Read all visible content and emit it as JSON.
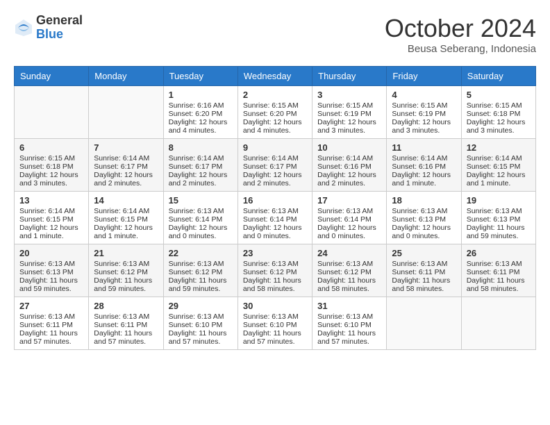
{
  "header": {
    "logo_general": "General",
    "logo_blue": "Blue",
    "month": "October 2024",
    "location": "Beusa Seberang, Indonesia"
  },
  "days_of_week": [
    "Sunday",
    "Monday",
    "Tuesday",
    "Wednesday",
    "Thursday",
    "Friday",
    "Saturday"
  ],
  "weeks": [
    [
      {
        "day": "",
        "sunrise": "",
        "sunset": "",
        "daylight": ""
      },
      {
        "day": "",
        "sunrise": "",
        "sunset": "",
        "daylight": ""
      },
      {
        "day": "1",
        "sunrise": "Sunrise: 6:16 AM",
        "sunset": "Sunset: 6:20 PM",
        "daylight": "Daylight: 12 hours and 4 minutes."
      },
      {
        "day": "2",
        "sunrise": "Sunrise: 6:15 AM",
        "sunset": "Sunset: 6:20 PM",
        "daylight": "Daylight: 12 hours and 4 minutes."
      },
      {
        "day": "3",
        "sunrise": "Sunrise: 6:15 AM",
        "sunset": "Sunset: 6:19 PM",
        "daylight": "Daylight: 12 hours and 3 minutes."
      },
      {
        "day": "4",
        "sunrise": "Sunrise: 6:15 AM",
        "sunset": "Sunset: 6:19 PM",
        "daylight": "Daylight: 12 hours and 3 minutes."
      },
      {
        "day": "5",
        "sunrise": "Sunrise: 6:15 AM",
        "sunset": "Sunset: 6:18 PM",
        "daylight": "Daylight: 12 hours and 3 minutes."
      }
    ],
    [
      {
        "day": "6",
        "sunrise": "Sunrise: 6:15 AM",
        "sunset": "Sunset: 6:18 PM",
        "daylight": "Daylight: 12 hours and 3 minutes."
      },
      {
        "day": "7",
        "sunrise": "Sunrise: 6:14 AM",
        "sunset": "Sunset: 6:17 PM",
        "daylight": "Daylight: 12 hours and 2 minutes."
      },
      {
        "day": "8",
        "sunrise": "Sunrise: 6:14 AM",
        "sunset": "Sunset: 6:17 PM",
        "daylight": "Daylight: 12 hours and 2 minutes."
      },
      {
        "day": "9",
        "sunrise": "Sunrise: 6:14 AM",
        "sunset": "Sunset: 6:17 PM",
        "daylight": "Daylight: 12 hours and 2 minutes."
      },
      {
        "day": "10",
        "sunrise": "Sunrise: 6:14 AM",
        "sunset": "Sunset: 6:16 PM",
        "daylight": "Daylight: 12 hours and 2 minutes."
      },
      {
        "day": "11",
        "sunrise": "Sunrise: 6:14 AM",
        "sunset": "Sunset: 6:16 PM",
        "daylight": "Daylight: 12 hours and 1 minute."
      },
      {
        "day": "12",
        "sunrise": "Sunrise: 6:14 AM",
        "sunset": "Sunset: 6:15 PM",
        "daylight": "Daylight: 12 hours and 1 minute."
      }
    ],
    [
      {
        "day": "13",
        "sunrise": "Sunrise: 6:14 AM",
        "sunset": "Sunset: 6:15 PM",
        "daylight": "Daylight: 12 hours and 1 minute."
      },
      {
        "day": "14",
        "sunrise": "Sunrise: 6:14 AM",
        "sunset": "Sunset: 6:15 PM",
        "daylight": "Daylight: 12 hours and 1 minute."
      },
      {
        "day": "15",
        "sunrise": "Sunrise: 6:13 AM",
        "sunset": "Sunset: 6:14 PM",
        "daylight": "Daylight: 12 hours and 0 minutes."
      },
      {
        "day": "16",
        "sunrise": "Sunrise: 6:13 AM",
        "sunset": "Sunset: 6:14 PM",
        "daylight": "Daylight: 12 hours and 0 minutes."
      },
      {
        "day": "17",
        "sunrise": "Sunrise: 6:13 AM",
        "sunset": "Sunset: 6:14 PM",
        "daylight": "Daylight: 12 hours and 0 minutes."
      },
      {
        "day": "18",
        "sunrise": "Sunrise: 6:13 AM",
        "sunset": "Sunset: 6:13 PM",
        "daylight": "Daylight: 12 hours and 0 minutes."
      },
      {
        "day": "19",
        "sunrise": "Sunrise: 6:13 AM",
        "sunset": "Sunset: 6:13 PM",
        "daylight": "Daylight: 11 hours and 59 minutes."
      }
    ],
    [
      {
        "day": "20",
        "sunrise": "Sunrise: 6:13 AM",
        "sunset": "Sunset: 6:13 PM",
        "daylight": "Daylight: 11 hours and 59 minutes."
      },
      {
        "day": "21",
        "sunrise": "Sunrise: 6:13 AM",
        "sunset": "Sunset: 6:12 PM",
        "daylight": "Daylight: 11 hours and 59 minutes."
      },
      {
        "day": "22",
        "sunrise": "Sunrise: 6:13 AM",
        "sunset": "Sunset: 6:12 PM",
        "daylight": "Daylight: 11 hours and 59 minutes."
      },
      {
        "day": "23",
        "sunrise": "Sunrise: 6:13 AM",
        "sunset": "Sunset: 6:12 PM",
        "daylight": "Daylight: 11 hours and 58 minutes."
      },
      {
        "day": "24",
        "sunrise": "Sunrise: 6:13 AM",
        "sunset": "Sunset: 6:12 PM",
        "daylight": "Daylight: 11 hours and 58 minutes."
      },
      {
        "day": "25",
        "sunrise": "Sunrise: 6:13 AM",
        "sunset": "Sunset: 6:11 PM",
        "daylight": "Daylight: 11 hours and 58 minutes."
      },
      {
        "day": "26",
        "sunrise": "Sunrise: 6:13 AM",
        "sunset": "Sunset: 6:11 PM",
        "daylight": "Daylight: 11 hours and 58 minutes."
      }
    ],
    [
      {
        "day": "27",
        "sunrise": "Sunrise: 6:13 AM",
        "sunset": "Sunset: 6:11 PM",
        "daylight": "Daylight: 11 hours and 57 minutes."
      },
      {
        "day": "28",
        "sunrise": "Sunrise: 6:13 AM",
        "sunset": "Sunset: 6:11 PM",
        "daylight": "Daylight: 11 hours and 57 minutes."
      },
      {
        "day": "29",
        "sunrise": "Sunrise: 6:13 AM",
        "sunset": "Sunset: 6:10 PM",
        "daylight": "Daylight: 11 hours and 57 minutes."
      },
      {
        "day": "30",
        "sunrise": "Sunrise: 6:13 AM",
        "sunset": "Sunset: 6:10 PM",
        "daylight": "Daylight: 11 hours and 57 minutes."
      },
      {
        "day": "31",
        "sunrise": "Sunrise: 6:13 AM",
        "sunset": "Sunset: 6:10 PM",
        "daylight": "Daylight: 11 hours and 57 minutes."
      },
      {
        "day": "",
        "sunrise": "",
        "sunset": "",
        "daylight": ""
      },
      {
        "day": "",
        "sunrise": "",
        "sunset": "",
        "daylight": ""
      }
    ]
  ],
  "row_shades": [
    "row-white",
    "row-shade",
    "row-white",
    "row-shade",
    "row-white"
  ]
}
